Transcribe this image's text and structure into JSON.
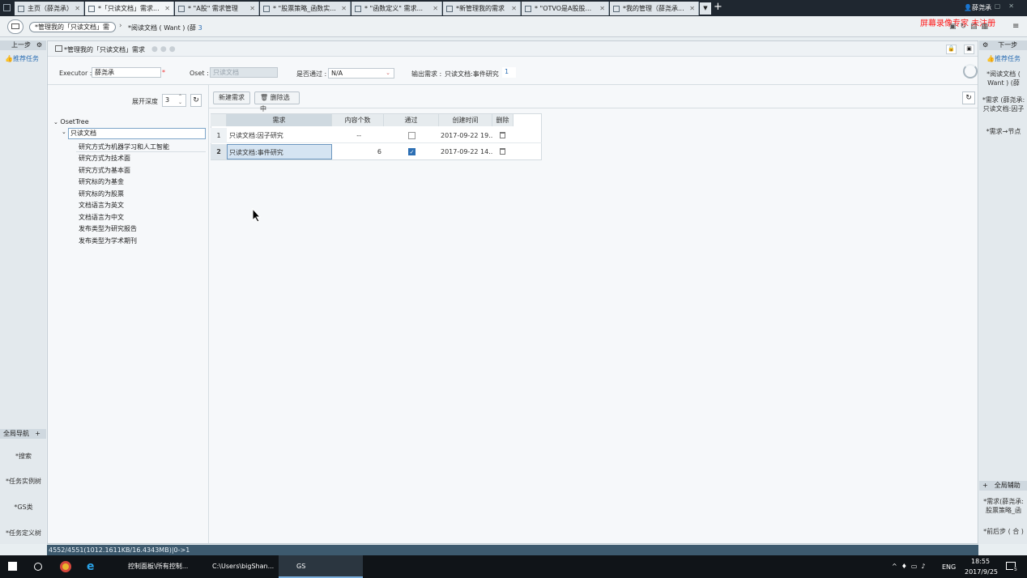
{
  "tabs": [
    {
      "label": "主页（薛尧承）"
    },
    {
      "label": "*「只读文档」需求..."
    },
    {
      "label": "* \"A股\" 需求管理"
    },
    {
      "label": "* \"股票策略_函数实..."
    },
    {
      "label": "* \"函数定义\" 需求..."
    },
    {
      "label": "*新管理我的需求"
    },
    {
      "label": "* \"OTVO是A股股..."
    },
    {
      "label": "*我的管理（薛尧承..."
    }
  ],
  "header": {
    "user": "薛尧承",
    "breadcrumb_1": "*管理我的「只读文档」需",
    "breadcrumb_2": "*阅读文档 ( Want ) (薛",
    "breadcrumb_2_count": "3",
    "watermark": "屏幕录像专家 未注册"
  },
  "left_panel": {
    "prev_step": "上一步",
    "pending_tasks": "推荐任务",
    "global_nav": "全局导航",
    "nav_items": [
      "*搜索",
      "*任务实例树",
      "*GS类",
      "*任务定义树"
    ]
  },
  "right_panel": {
    "next_step": "下一步",
    "pending_tasks": "推荐任务",
    "items": [
      "*阅读文档 ( Want ) (薛",
      "*需求 (薛尧承: 只读文档:因子",
      "*需求→节点"
    ],
    "global_help": "全局辅助",
    "help_items": [
      "*需求(薛尧承: 股票策略_函",
      "*前后步 ( 合 )"
    ]
  },
  "panel": {
    "title": "*管理我的「只读文档」需求",
    "executor_label": "Executor :",
    "executor_value": "薛尧承",
    "oset_label": "Oset :",
    "oset_placeholder": "只读文档",
    "passed_label": "是否通过 :",
    "passed_value": "N/A",
    "output_label": "输出需求 :",
    "output_value": "只读文档:事件研究",
    "output_count": "1",
    "depth_label": "展开深度",
    "depth_value": "3"
  },
  "tree": {
    "root": "OsetTree",
    "node": "只读文档",
    "children": [
      "研究方式为机器学习和人工智能",
      "研究方式为技术面",
      "研究方式为基本面",
      "研究标的为基金",
      "研究标的为股票",
      "文档语言为英文",
      "文档语言为中文",
      "发布类型为研究报告",
      "发布类型为学术期刊"
    ]
  },
  "toolbar_buttons": {
    "new_requirement": "新建需求",
    "delete_selected": "删除选中"
  },
  "grid": {
    "columns": [
      "需求",
      "内容个数",
      "通过",
      "创建时间",
      "删除"
    ],
    "rows": [
      {
        "num": "1",
        "req": "只读文档:因子研究",
        "count": "--",
        "passed": false,
        "time": "2017-09-22 19..."
      },
      {
        "num": "2",
        "req": "只读文档:事件研究",
        "count": "6",
        "passed": true,
        "time": "2017-09-22 14..."
      }
    ]
  },
  "status_bar": "4552/4551(1012.1611KB/16.4343MB)|0->1",
  "taskbar": {
    "items": [
      "控制面板\\所有控制...",
      "C:\\Users\\bigShan...",
      "GS"
    ],
    "lang": "ENG",
    "time": "18:55",
    "date": "2017/9/25",
    "notif_count": "5"
  }
}
